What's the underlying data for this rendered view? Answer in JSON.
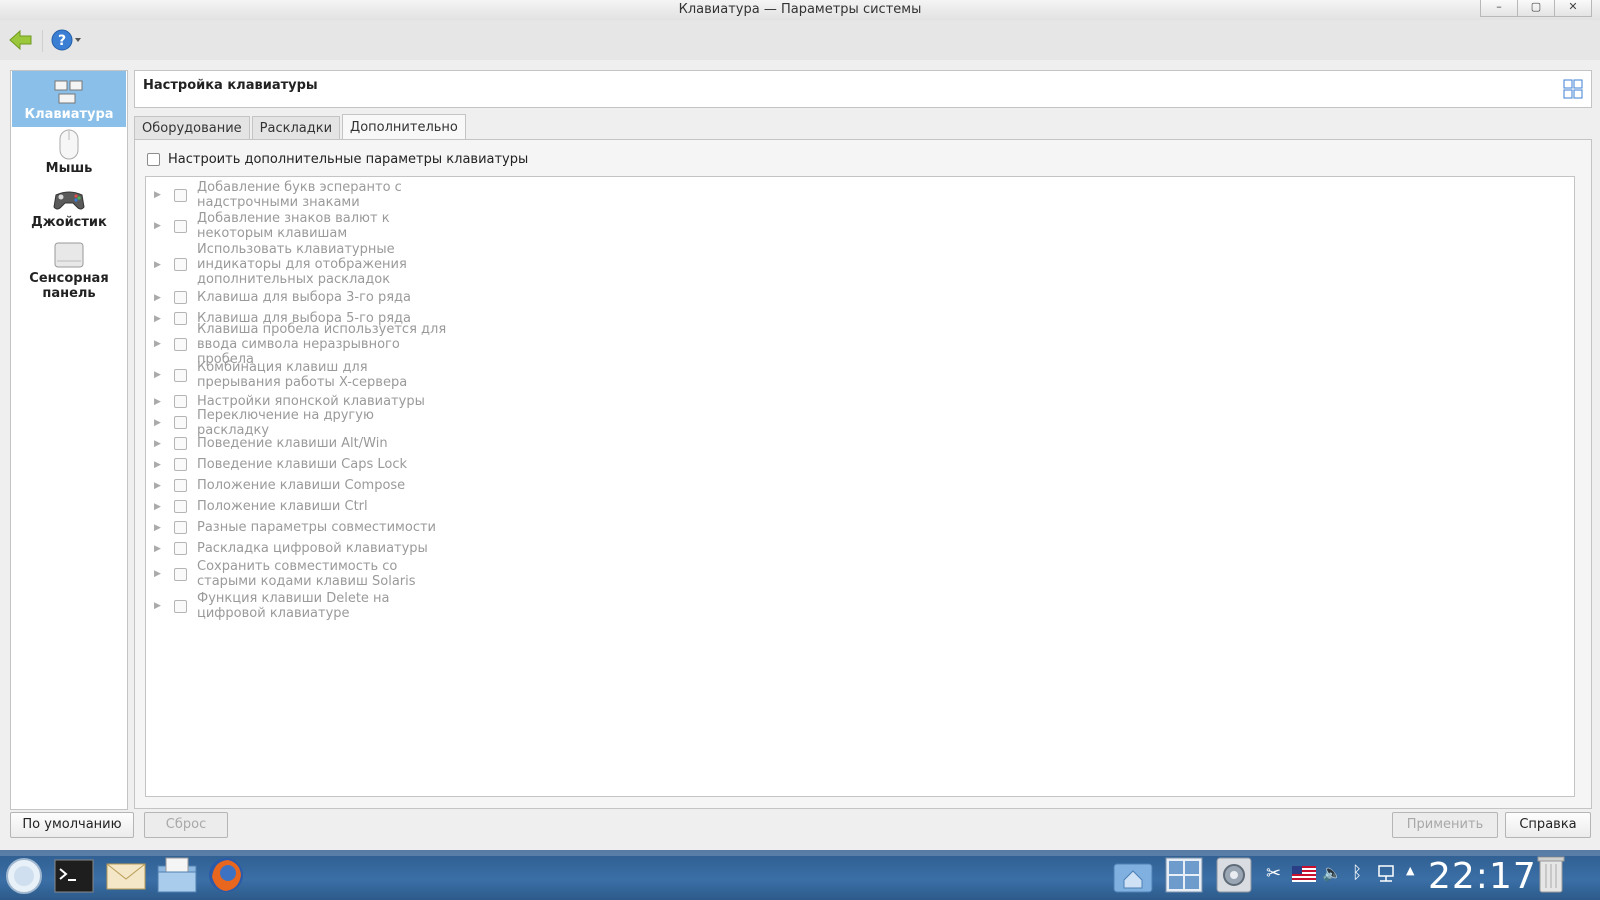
{
  "window": {
    "title": "Клавиатура — Параметры системы",
    "minimize": "–",
    "maximize": "▢",
    "close": "✕"
  },
  "toolbar": {
    "back_icon": "back-arrow-icon",
    "help_icon": "help-icon"
  },
  "sidebar": {
    "items": [
      {
        "label": "Клавиатура",
        "icon": "keyboard-icon",
        "active": true
      },
      {
        "label": "Мышь",
        "icon": "mouse-icon",
        "active": false
      },
      {
        "label": "Джойстик",
        "icon": "joystick-icon",
        "active": false
      },
      {
        "label": "Сенсорная панель",
        "icon": "touchpad-icon",
        "active": false
      }
    ]
  },
  "header": {
    "title": "Настройка клавиатуры"
  },
  "tabs": [
    "Оборудование",
    "Раскладки",
    "Дополнительно"
  ],
  "active_tab": 2,
  "advanced": {
    "main_checkbox_label": "Настроить дополнительные параметры клавиатуры",
    "options": [
      "Добавление букв эсперанто с надстрочными знаками",
      "Добавление знаков валют к некоторым клавишам",
      "Использовать клавиатурные индикаторы для отображения дополнительных раскладок",
      "Клавиша для выбора 3-го ряда",
      "Клавиша для выбора 5-го ряда",
      "Клавиша пробела используется для ввода символа неразрывного пробела",
      "Комбинация клавиш для прерывания работы X-сервера",
      "Настройки японской клавиатуры",
      "Переключение на другую раскладку",
      "Поведение клавиши Alt/Win",
      "Поведение клавиши Caps Lock",
      "Положение клавиши Compose",
      "Положение клавиши Ctrl",
      "Разные параметры совместимости",
      "Раскладка цифровой клавиатуры",
      "Сохранить совместимость со старыми кодами клавиш Solaris",
      "Функция клавиши Delete на цифровой клавиатуре"
    ]
  },
  "buttons": {
    "defaults": "По умолчанию",
    "reset": "Сброс",
    "apply": "Применить",
    "help": "Справка"
  },
  "taskbar": {
    "clock": "22:17"
  }
}
